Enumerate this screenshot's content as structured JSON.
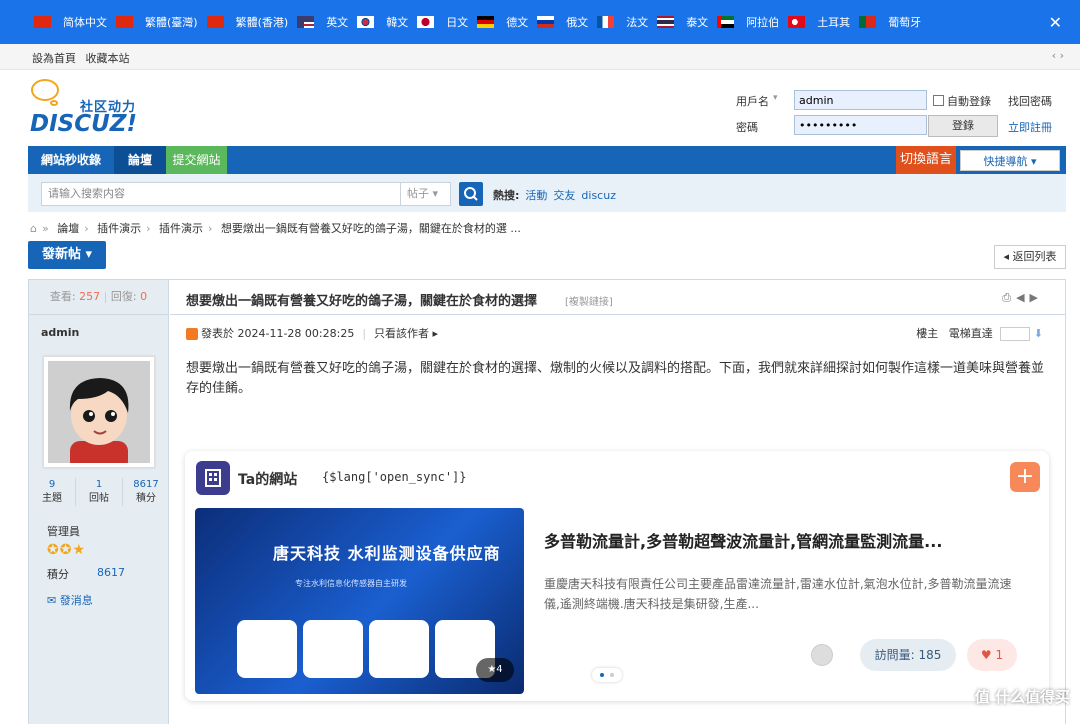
{
  "languages": [
    {
      "label": "简体中文",
      "flag": "cn"
    },
    {
      "label": "繁體(臺灣)",
      "flag": "cn"
    },
    {
      "label": "繁體(香港)",
      "flag": "cn"
    },
    {
      "label": "英文",
      "flag": "us"
    },
    {
      "label": "韓文",
      "flag": "kr"
    },
    {
      "label": "日文",
      "flag": "jp"
    },
    {
      "label": "德文",
      "flag": "de"
    },
    {
      "label": "俄文",
      "flag": "ru"
    },
    {
      "label": "法文",
      "flag": "fr"
    },
    {
      "label": "泰文",
      "flag": "th"
    },
    {
      "label": "阿拉伯",
      "flag": "ae"
    },
    {
      "label": "土耳其",
      "flag": "tr"
    },
    {
      "label": "葡萄牙",
      "flag": "pt"
    }
  ],
  "lang_close": "✕",
  "topbar": {
    "set_home": "設為首頁",
    "favorite": "收藏本站",
    "arrows": "‹ ›"
  },
  "logo": {
    "tagline": "社区动力",
    "brand": "DISCUZ!"
  },
  "login": {
    "username_label": "用戶名",
    "username_value": "admin",
    "password_label": "密碼",
    "password_value": "•••••••••",
    "auto_login": "自動登錄",
    "login_button": "登錄",
    "forgot": "找回密碼",
    "register": "立即註冊"
  },
  "nav": {
    "items": [
      "網站秒收錄",
      "論壇",
      "提交網站"
    ],
    "switch_lang": "切換語言",
    "quick_nav": "快捷導航 ▾"
  },
  "search": {
    "placeholder": "请输入搜索内容",
    "type": "帖子 ▾",
    "hot_label": "熱搜:",
    "hot_keywords": [
      "活動",
      "交友",
      "discuz"
    ]
  },
  "breadcrumb": [
    "論壇",
    "插件演示",
    "插件演示",
    "想要燉出一鍋既有營養又好吃的鴿子湯，關鍵在於食材的選 ..."
  ],
  "post_button": "發新帖 ▾",
  "back_button": "◂ 返回列表",
  "thread": {
    "views_label": "查看:",
    "views": "257",
    "replies_label": "回復:",
    "replies": "0",
    "title": "想要燉出一鍋既有營養又好吃的鴿子湯，關鍵在於食材的選擇",
    "copy_link": "[複製鏈接]",
    "posted_at": "發表於 2024-11-28 00:28:25",
    "author_only": "只看該作者 ▸",
    "floor_label": "樓主",
    "jump_label": "電梯直達",
    "content": "想要燉出一鍋既有營養又好吃的鴿子湯，關鍵在於食材的選擇、燉制的火候以及調料的搭配。下面，我們就來詳細探討如何製作這樣一道美味與營養並存的佳餚。"
  },
  "author": {
    "name": "admin",
    "stats": [
      {
        "value": "9",
        "label": "主題"
      },
      {
        "value": "1",
        "label": "回帖"
      },
      {
        "value": "8617",
        "label": "積分"
      }
    ],
    "group": "管理員",
    "stars": "✪✪★",
    "score_label": "積分",
    "score": "8617",
    "message": "✉ 發消息"
  },
  "card": {
    "title": "Ta的網站",
    "sync": "{$lang['open_sync']}",
    "plus": "+",
    "banner_title": "唐天科技 水利监测设备供应商",
    "banner_sub": "专注水利信息化传感器自主研发",
    "banner_badge": "★4",
    "site_title": "多普勒流量計,多普勒超聲波流量計,管網流量監測流量...",
    "site_desc": "重慶唐天科技有限責任公司主要產品雷達流量計,雷達水位計,氣泡水位計,多普勒流量流速儀,遙測終端機.唐天科技是集研發,生產...",
    "visits_label": "訪問量:",
    "visits": "185",
    "likes": "1"
  },
  "watermark": "值 什么值得买",
  "colors": {
    "primary": "#1765b6",
    "lang_bar": "#1a73e8",
    "accent": "#e0501c",
    "green": "#5cb85c"
  }
}
